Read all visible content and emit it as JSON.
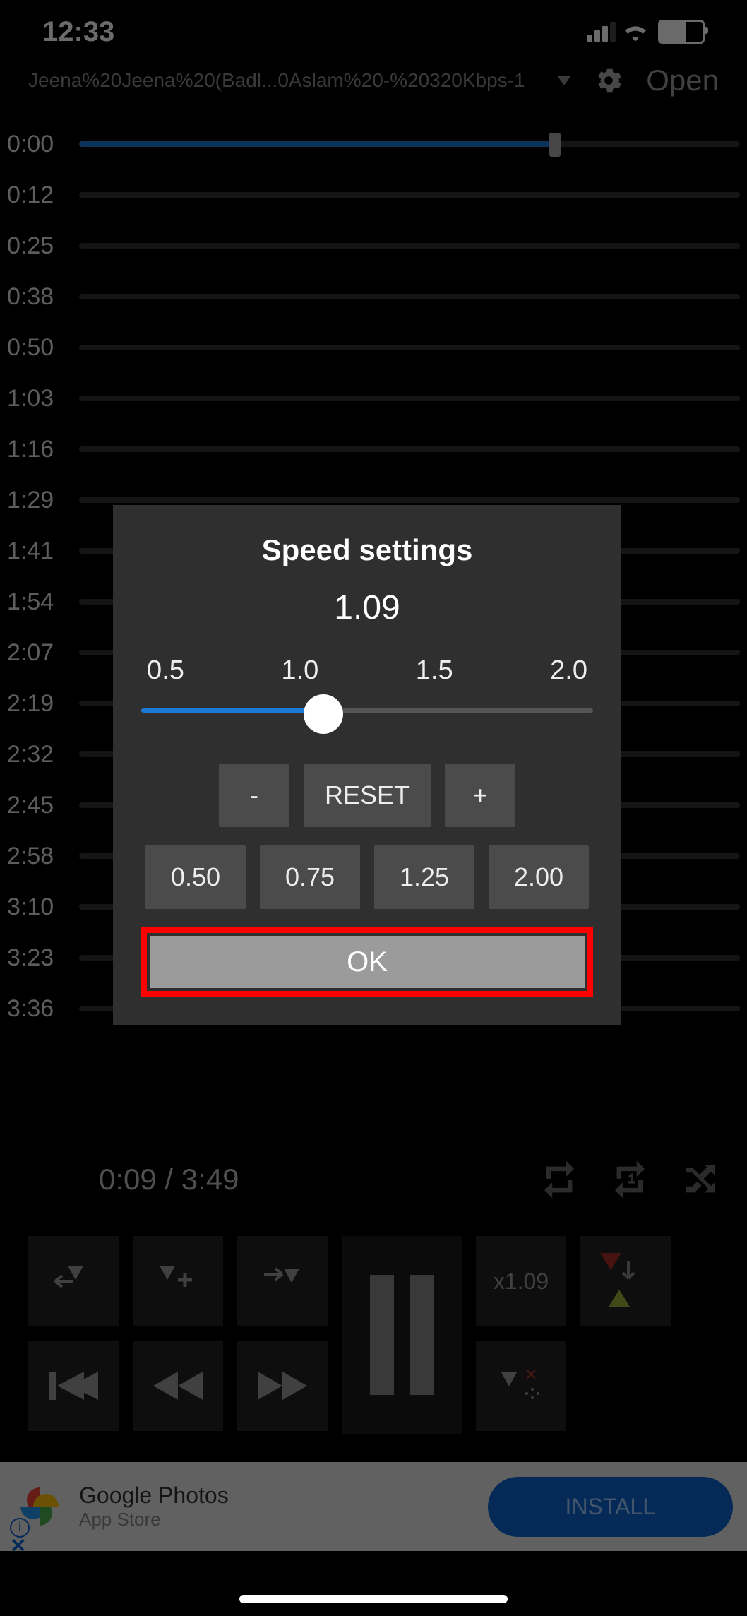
{
  "status": {
    "time": "12:33"
  },
  "header": {
    "filename": "Jeena%20Jeena%20(Badl...0Aslam%20-%20320Kbps-1",
    "open_label": "Open"
  },
  "rows": [
    {
      "label": "0:00",
      "progress": 72,
      "thumb": true
    },
    {
      "label": "0:12"
    },
    {
      "label": "0:25"
    },
    {
      "label": "0:38"
    },
    {
      "label": "0:50"
    },
    {
      "label": "1:03"
    },
    {
      "label": "1:16"
    },
    {
      "label": "1:29"
    },
    {
      "label": "1:41"
    },
    {
      "label": "1:54"
    },
    {
      "label": "2:07"
    },
    {
      "label": "2:19"
    },
    {
      "label": "2:32"
    },
    {
      "label": "2:45"
    },
    {
      "label": "2:58"
    },
    {
      "label": "3:10"
    },
    {
      "label": "3:23"
    },
    {
      "label": "3:36"
    }
  ],
  "modal": {
    "title": "Speed settings",
    "value": "1.09",
    "ticks": [
      "0.5",
      "1.0",
      "1.5",
      "2.0"
    ],
    "minus": "-",
    "reset": "RESET",
    "plus": "+",
    "presets": [
      "0.50",
      "0.75",
      "1.25",
      "2.00"
    ],
    "ok": "OK"
  },
  "playback": {
    "elapsed": "0:09 / 3:49",
    "speed_btn": "x1.09"
  },
  "ad": {
    "title": "Google Photos",
    "sub": "App Store",
    "cta": "INSTALL"
  }
}
